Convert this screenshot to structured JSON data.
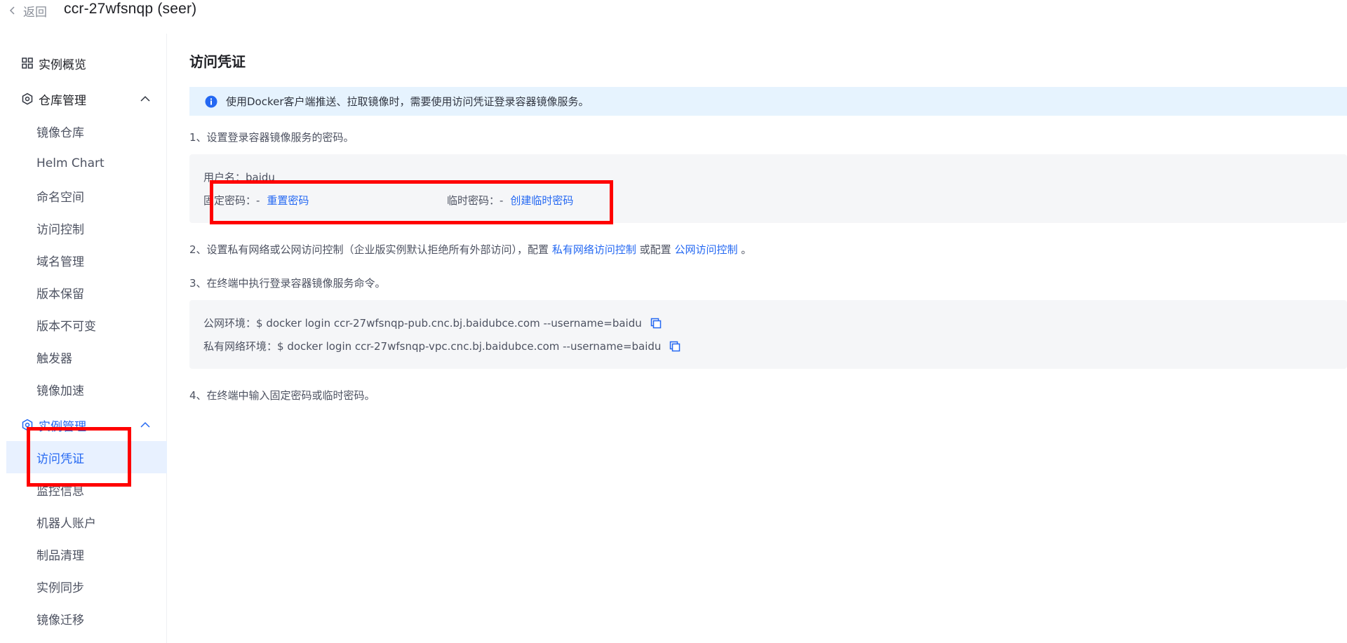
{
  "header": {
    "back_label": "返回",
    "title": "ccr-27wfsnqp (seer)"
  },
  "sidebar": {
    "overview": "实例概览",
    "repo_group": {
      "label": "仓库管理",
      "items": [
        "镜像仓库",
        "Helm Chart",
        "命名空间",
        "访问控制",
        "域名管理",
        "版本保留",
        "版本不可变",
        "触发器",
        "镜像加速"
      ]
    },
    "instance_group": {
      "label": "实例管理",
      "items": [
        "访问凭证",
        "监控信息",
        "机器人账户",
        "制品清理",
        "实例同步",
        "镜像迁移"
      ],
      "selected": "访问凭证"
    }
  },
  "main": {
    "title": "访问凭证",
    "banner": "使用Docker客户端推送、拉取镜像时，需要使用访问凭证登录容器镜像服务。",
    "step1": "1、设置登录容器镜像服务的密码。",
    "username_label": "用户名：",
    "username_value": "baidu",
    "fixed_pwd_label": "固定密码：-",
    "reset_pwd_link": "重置密码",
    "temp_pwd_label": "临时密码：-",
    "create_temp_link": "创建临时密码",
    "step2_prefix": "2、设置私有网络或公网访问控制（企业版实例默认拒绝所有外部访问），配置",
    "step2_link1": "私有网络访问控制",
    "step2_mid": "或配置",
    "step2_link2": "公网访问控制",
    "step2_suffix": "。",
    "step3": "3、在终端中执行登录容器镜像服务命令。",
    "public_env_label": "公网环境：",
    "public_env_cmd": "$ docker login ccr-27wfsnqp-pub.cnc.bj.baidubce.com --username=baidu",
    "private_env_label": "私有网络环境：",
    "private_env_cmd": "$ docker login ccr-27wfsnqp-vpc.cnc.bj.baidubce.com --username=baidu",
    "step4": "4、在终端中输入固定密码或临时密码。"
  },
  "colors": {
    "accent": "#2468f2",
    "banner_bg": "#e6f3fe",
    "box_bg": "#f5f6f8",
    "annotation": "#ff0000"
  },
  "icons": [
    "chevron-left-icon",
    "grid-icon",
    "repo-gear-icon",
    "chevron-up-icon",
    "instance-gear-icon",
    "info-icon",
    "copy-icon"
  ]
}
